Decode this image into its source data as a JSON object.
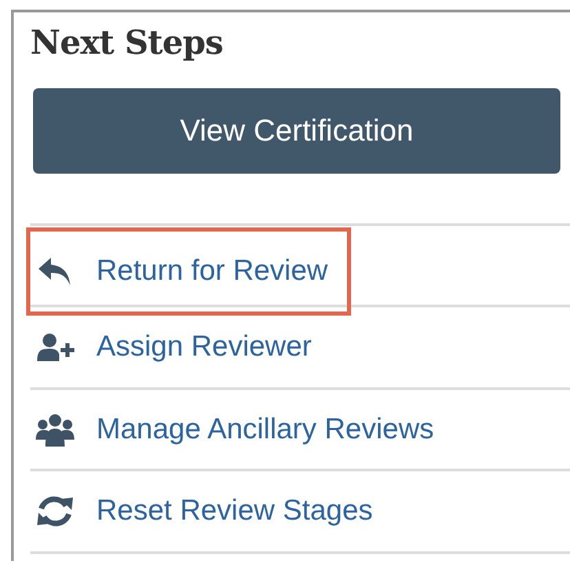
{
  "panel": {
    "title": "Next Steps"
  },
  "primary_button": {
    "label": "View Certification"
  },
  "steps": [
    {
      "kind": "return",
      "label": "Return for Review",
      "highlighted": true
    },
    {
      "kind": "assign",
      "label": "Assign Reviewer",
      "highlighted": false
    },
    {
      "kind": "ancillary",
      "label": "Manage Ancillary Reviews",
      "highlighted": false
    },
    {
      "kind": "reset",
      "label": "Reset Review Stages",
      "highlighted": false
    }
  ]
}
